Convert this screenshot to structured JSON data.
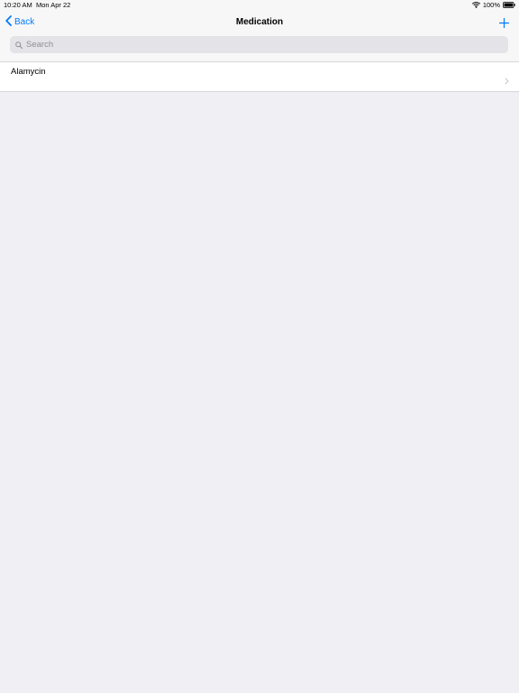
{
  "status_bar": {
    "time": "10:20 AM",
    "date": "Mon Apr 22",
    "battery": "100%",
    "icons": [
      "wifi-icon",
      "battery-icon"
    ]
  },
  "nav": {
    "back_label": "Back",
    "title": "Medication",
    "add_icon": "plus-icon",
    "accent_color": "#007aff"
  },
  "search": {
    "placeholder": "Search"
  },
  "list": {
    "items": [
      {
        "label": "Alamycin"
      }
    ]
  }
}
